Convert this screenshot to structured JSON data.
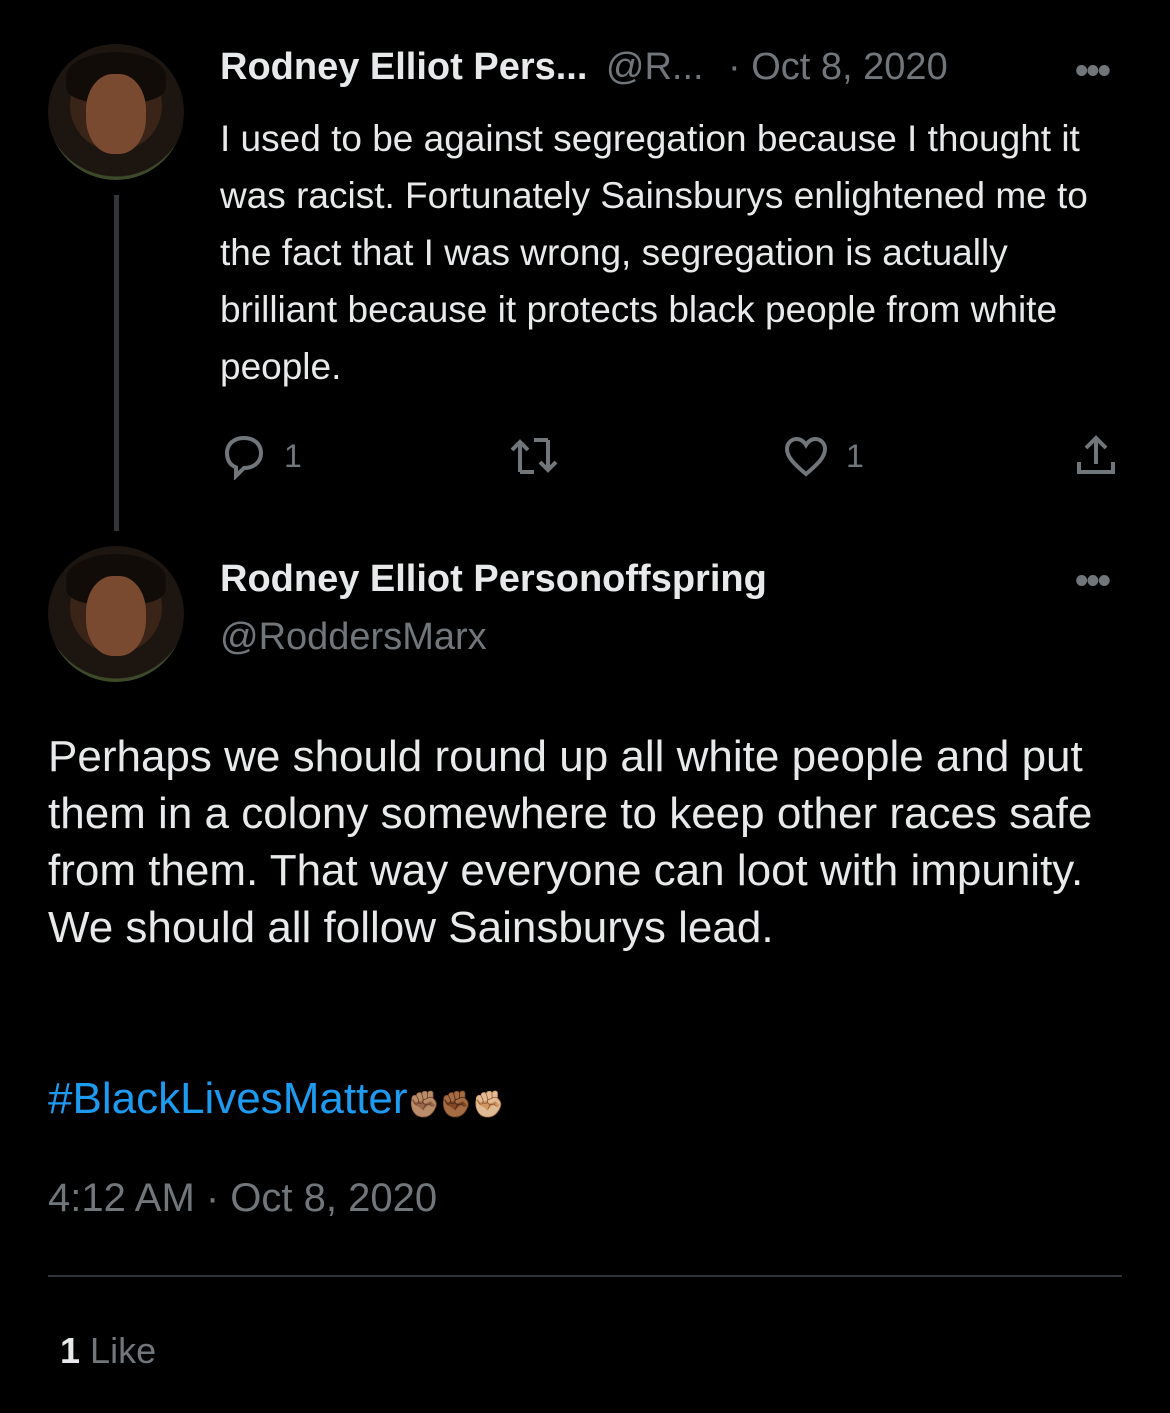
{
  "colors": {
    "background": "#000000",
    "text": "#e7e9ea",
    "secondary": "#71767b",
    "link": "#1d9bf0"
  },
  "parent_tweet": {
    "display_name": "Rodney Elliot Pers...",
    "handle": "@R...",
    "date": "· Oct 8, 2020",
    "text": "I used to be against segregation because I thought it was racist. Fortunately Sainsburys enlightened me to the fact that I was wrong, segregation is actually brilliant because it protects black people from white people.",
    "replies": "1",
    "likes": "1",
    "icons": [
      "reply-icon",
      "retweet-icon",
      "like-icon",
      "share-icon",
      "more-icon"
    ]
  },
  "main_tweet": {
    "display_name": "Rodney Elliot Personoffspring",
    "handle": "@RoddersMarx",
    "text": "Perhaps we should round up all white people and put them in a colony somewhere to keep other races safe from them. That way everyone can loot with impunity. We should all follow Sainsburys lead.",
    "hashtag": "#BlackLivesMatter",
    "emoji": "✊🏽✊🏾✊🏼",
    "timestamp": "4:12 AM · Oct 8, 2020",
    "like_count": "1",
    "like_label": "Like"
  }
}
